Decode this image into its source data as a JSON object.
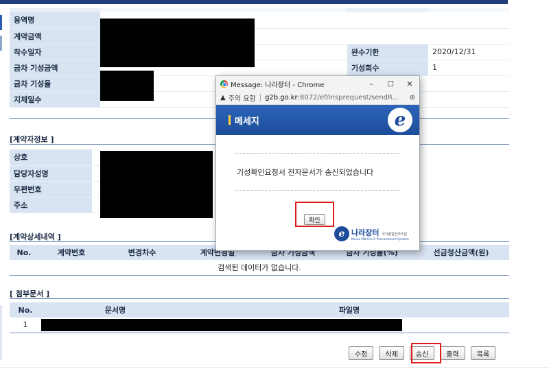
{
  "contract_info": {
    "rows": [
      {
        "label": "용역명",
        "value": "",
        "label2": "",
        "value2": ""
      },
      {
        "label": "계약금액",
        "value": "",
        "label2": "",
        "value2": ""
      },
      {
        "label": "착수일자",
        "value": "",
        "label2": "완수기한",
        "value2": "2020/12/31"
      },
      {
        "label": "금차 기성금액",
        "value": "",
        "label2": "기성회수",
        "value2": "1"
      },
      {
        "label": "금차 기성율",
        "value": "",
        "label2": "",
        "value2": ""
      },
      {
        "label": "지체일수",
        "value": "",
        "label2": "",
        "value2": ""
      }
    ]
  },
  "contractor": {
    "title": "[계약자정보 ]",
    "rows": [
      {
        "label": "상호"
      },
      {
        "label": "담당자성명"
      },
      {
        "label": "우편번호"
      },
      {
        "label": "주소"
      }
    ]
  },
  "contract_detail": {
    "title": "[계약상세내역 ]",
    "columns": [
      "No.",
      "계약번호",
      "변경차수",
      "계약변경일",
      "금차 기성금액",
      "금차 기성율(%)",
      "선금청산금액(원)"
    ],
    "empty_message": "검색된 데이터가 없습니다."
  },
  "attachments": {
    "title": "[ 첨부문서 ]",
    "columns": [
      "No.",
      "문서명",
      "파일명"
    ],
    "rows": [
      {
        "no": "1"
      }
    ]
  },
  "buttons": {
    "edit": "수정",
    "delete": "삭제",
    "send": "송신",
    "print": "출력",
    "list": "목록"
  },
  "popup": {
    "window_title": "Message: 나라장터 - Chrome",
    "security_label": "주의 요함",
    "url_host": "g2b.go.kr",
    "url_path": ":8072/ef/insprequest/sendR...",
    "header_title": "메세지",
    "message": "기성확인요청서 전자문서가 송신되었습니다",
    "ok_button": "확인",
    "brand_name": "나라장터",
    "brand_small": "국가종합전자조달",
    "brand_sub": "Korea ON-line E-Procurement System",
    "logo_letter": "e"
  },
  "colors": {
    "accent": "#1d4d9a",
    "label_bg": "#d9e4f3",
    "highlight": "#e01b1b"
  }
}
